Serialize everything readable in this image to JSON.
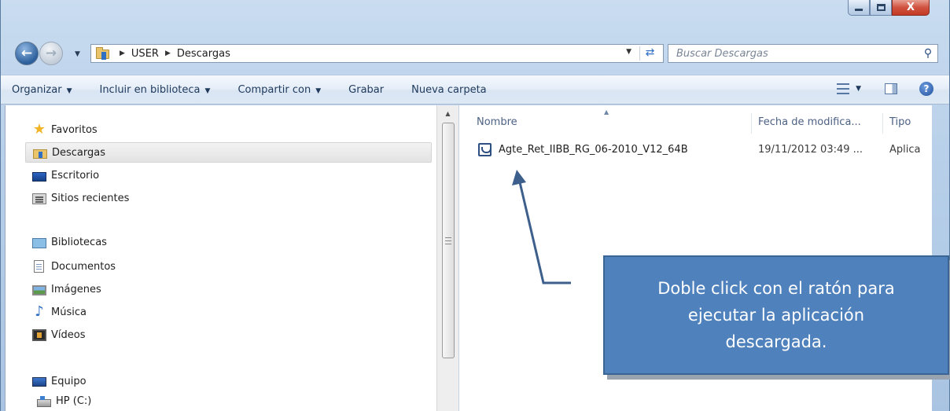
{
  "window": {
    "caption_buttons": {
      "minimize": "minimize",
      "maximize": "maximize",
      "close": "X"
    }
  },
  "address_bar": {
    "breadcrumbs": [
      "USER",
      "Descargas"
    ]
  },
  "search": {
    "placeholder": "Buscar Descargas"
  },
  "toolbar": {
    "organize": "Organizar",
    "include_library": "Incluir en biblioteca",
    "share": "Compartir con",
    "burn": "Grabar",
    "new_folder": "Nueva carpeta"
  },
  "sidebar": {
    "items": [
      {
        "label": "Favoritos",
        "icon": "star-icon",
        "selected": false
      },
      {
        "label": "Descargas",
        "icon": "downloads-folder-icon",
        "selected": true
      },
      {
        "label": "Escritorio",
        "icon": "desktop-icon",
        "selected": false
      },
      {
        "label": "Sitios recientes",
        "icon": "recent-places-icon",
        "selected": false
      },
      {
        "label": "Bibliotecas",
        "icon": "libraries-icon",
        "selected": false
      },
      {
        "label": "Documentos",
        "icon": "documents-icon",
        "selected": false
      },
      {
        "label": "Imágenes",
        "icon": "pictures-icon",
        "selected": false
      },
      {
        "label": "Música",
        "icon": "music-icon",
        "selected": false
      },
      {
        "label": "Vídeos",
        "icon": "videos-icon",
        "selected": false
      },
      {
        "label": "Equipo",
        "icon": "computer-icon",
        "selected": false
      },
      {
        "label": "HP (C:)",
        "icon": "drive-icon",
        "selected": false
      }
    ]
  },
  "file_list": {
    "columns": [
      "Nombre",
      "Fecha de modifica...",
      "Tipo"
    ],
    "rows": [
      {
        "name": "Agte_Ret_IIBB_RG_06-2010_V12_64B",
        "date": "19/11/2012 03:49 ...",
        "type": "Aplica",
        "icon": "application-icon"
      }
    ]
  },
  "annotation": {
    "text": "Doble click con el ratón para ejecutar la aplicación descargada."
  },
  "colors": {
    "callout_fill": "#4f81bd",
    "callout_border": "#3a6494",
    "arrow": "#3d5f8c"
  }
}
